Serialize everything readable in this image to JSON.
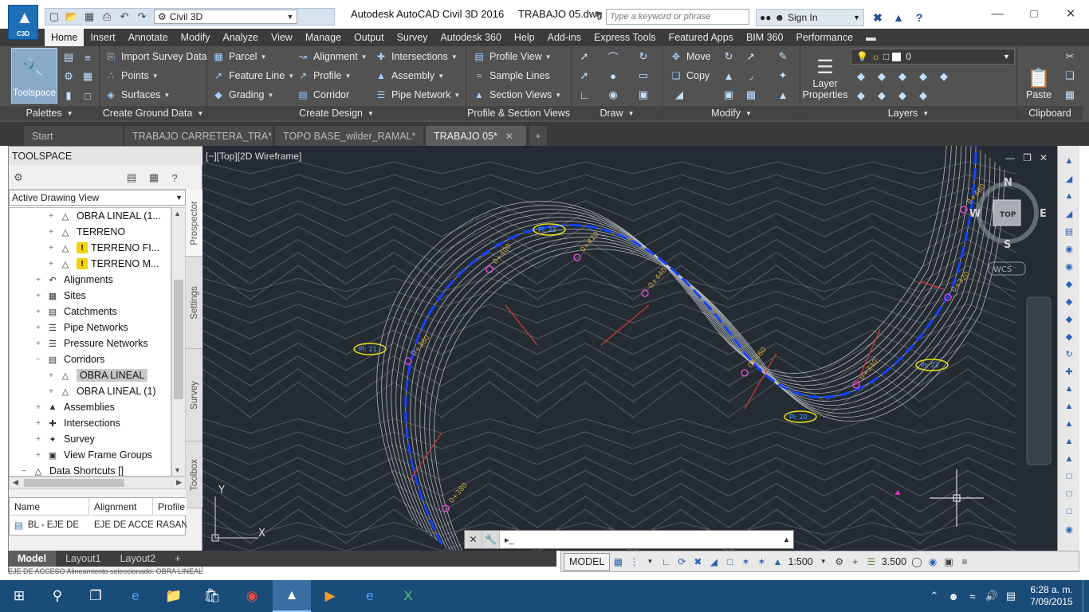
{
  "window": {
    "title": "Autodesk AutoCAD Civil 3D 2016     TRABAJO 05.dwg",
    "logo_label": "C3D",
    "workspace": "Civil 3D",
    "search_placeholder": "Type a keyword or phrase",
    "signin": "Sign In"
  },
  "ribbon_tabs": [
    "Home",
    "Insert",
    "Annotate",
    "Modify",
    "Analyze",
    "View",
    "Manage",
    "Output",
    "Survey",
    "Autodesk 360",
    "Help",
    "Add-ins",
    "Express Tools",
    "Featured Apps",
    "BIM 360",
    "Performance"
  ],
  "ribbon": {
    "palettes": {
      "title": "Palettes",
      "toolspace": "Toolspace"
    },
    "ground": {
      "title": "Create Ground Data",
      "import": "Import Survey Data",
      "points": "Points",
      "surfaces": "Surfaces"
    },
    "design": {
      "title": "Create Design",
      "parcel": "Parcel",
      "feature_line": "Feature Line",
      "grading": "Grading",
      "alignment": "Alignment",
      "profile": "Profile",
      "corridor": "Corridor",
      "intersections": "Intersections",
      "assembly": "Assembly",
      "pipe_network": "Pipe Network"
    },
    "views": {
      "title": "Profile & Section Views",
      "profile_view": "Profile View",
      "sample_lines": "Sample Lines",
      "section_views": "Section Views"
    },
    "draw": {
      "title": "Draw"
    },
    "modify": {
      "title": "Modify",
      "move": "Move",
      "copy": "Copy"
    },
    "layers": {
      "title": "Layers",
      "properties": "Layer Properties",
      "current": "0"
    },
    "clipboard": {
      "title": "Clipboard",
      "paste": "Paste"
    }
  },
  "doc_tabs": [
    {
      "label": "Start",
      "active": false
    },
    {
      "label": "TRABAJO CARRETERA_TRA*",
      "active": false
    },
    {
      "label": "TOPO BASE_wilder_RAMAL*",
      "active": false
    },
    {
      "label": "TRABAJO 05*",
      "active": true
    }
  ],
  "toolspace": {
    "title": "TOOLSPACE",
    "view": "Active Drawing View",
    "tree": [
      {
        "label": "OBRA LINEAL (1...",
        "level": 3,
        "warn": false,
        "sel": false
      },
      {
        "label": "TERRENO",
        "level": 3,
        "warn": false,
        "sel": false
      },
      {
        "label": "TERRENO FI...",
        "level": 3,
        "warn": true,
        "sel": false
      },
      {
        "label": "TERRENO M...",
        "level": 3,
        "warn": true,
        "sel": false
      },
      {
        "label": "Alignments",
        "level": 1,
        "warn": false,
        "sel": false
      },
      {
        "label": "Sites",
        "level": 1,
        "warn": false,
        "sel": false
      },
      {
        "label": "Catchments",
        "level": 1,
        "warn": false,
        "sel": false
      },
      {
        "label": "Pipe Networks",
        "level": 1,
        "warn": false,
        "sel": false
      },
      {
        "label": "Pressure Networks",
        "level": 1,
        "warn": false,
        "sel": false
      },
      {
        "label": "Corridors",
        "level": 1,
        "warn": false,
        "sel": false
      },
      {
        "label": "OBRA LINEAL",
        "level": 2,
        "warn": false,
        "sel": true
      },
      {
        "label": "OBRA LINEAL (1)",
        "level": 2,
        "warn": false,
        "sel": false
      },
      {
        "label": "Assemblies",
        "level": 1,
        "warn": false,
        "sel": false
      },
      {
        "label": "Intersections",
        "level": 1,
        "warn": false,
        "sel": false
      },
      {
        "label": "Survey",
        "level": 1,
        "warn": false,
        "sel": false
      },
      {
        "label": "View Frame Groups",
        "level": 1,
        "warn": false,
        "sel": false
      },
      {
        "label": "Data Shortcuts []",
        "level": 0,
        "warn": false,
        "sel": false
      }
    ],
    "side_tabs": [
      "Prospector",
      "Settings",
      "Survey",
      "Toolbox"
    ],
    "grid_headers": [
      "Name",
      "Alignment",
      "Profile"
    ],
    "grid_row": [
      "BL - EJE DE",
      "EJE DE ACCES",
      "RASAN"
    ]
  },
  "viewport": {
    "label": "[−][Top][2D Wireframe]",
    "compass": {
      "n": "N",
      "s": "S",
      "e": "E",
      "w": "W",
      "top": "TOP",
      "ucs": "WCS"
    },
    "stations": [
      "0+380",
      "0+360",
      "0+400",
      "0+420",
      "0+440",
      "0+460",
      "0+340",
      "0+320",
      "0+480"
    ],
    "tags": [
      "PI: 22",
      "PI: 21",
      "PI: 20",
      "PI: 23"
    ]
  },
  "command_line": {
    "prompt": "▸_"
  },
  "layout_tabs": [
    "Model",
    "Layout1",
    "Layout2"
  ],
  "status": {
    "model": "MODEL",
    "scale": "1:500",
    "lineweight": "3.500"
  },
  "below_status": "EJE DE ACCESO     Alineamiento seleccionado: OBRA LINEAL",
  "taskbar": {
    "time": "6:28 a. m.",
    "date": "7/09/2015"
  }
}
